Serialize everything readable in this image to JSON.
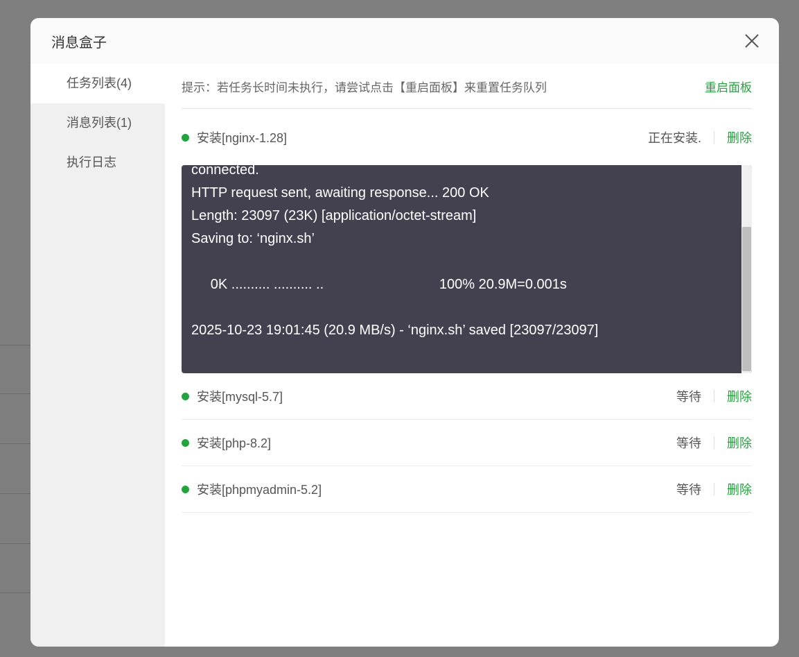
{
  "dialog": {
    "title": "消息盒子"
  },
  "sidebar": {
    "items": [
      {
        "label": "任务列表(4)"
      },
      {
        "label": "消息列表(1)"
      },
      {
        "label": "执行日志"
      }
    ]
  },
  "tip": {
    "text": "提示：若任务长时间未执行，请尝试点击【重启面板】来重置任务队列",
    "restart_label": "重启面板"
  },
  "tasks": [
    {
      "name": "安装[nginx-1.28]",
      "status": "正在安装.",
      "delete": "删除"
    },
    {
      "name": "安装[mysql-5.7]",
      "status": "等待",
      "delete": "删除"
    },
    {
      "name": "安装[php-8.2]",
      "status": "等待",
      "delete": "删除"
    },
    {
      "name": "安装[phpmyadmin-5.2]",
      "status": "等待",
      "delete": "删除"
    }
  ],
  "log": {
    "text": "connected.\nHTTP request sent, awaiting response... 200 OK\nLength: 23097 (23K) [application/octet-stream]\nSaving to: ‘nginx.sh’\n\n     0K .......... .......... ..                              100% 20.9M=0.001s\n\n2025-10-23 19:01:45 (20.9 MB/s) - ‘nginx.sh’ saved [23097/23097]\n"
  },
  "colors": {
    "accent": "#20a53a",
    "log_bg": "#434150"
  }
}
